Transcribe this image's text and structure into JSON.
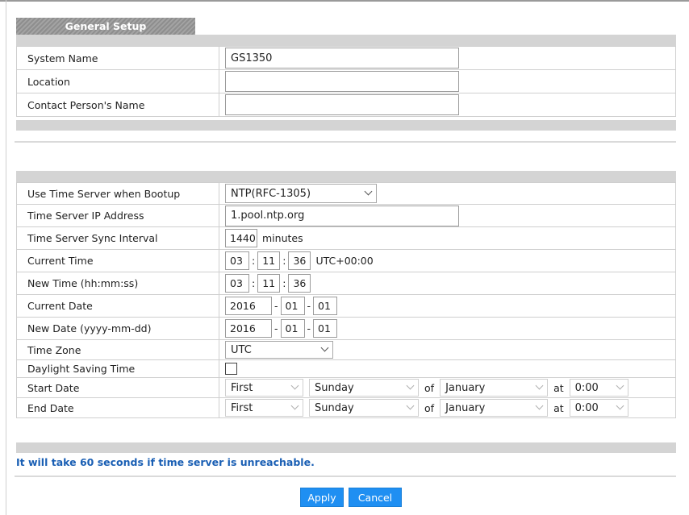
{
  "tab_title": "General Setup",
  "system": {
    "rows": [
      {
        "label": "System Name",
        "value": "GS1350"
      },
      {
        "label": "Location",
        "value": ""
      },
      {
        "label": "Contact Person's Name",
        "value": ""
      }
    ]
  },
  "time": {
    "time_server": {
      "label": "Use Time Server when Bootup",
      "selected": "NTP(RFC-1305)"
    },
    "server_ip": {
      "label": "Time Server IP Address",
      "value": "1.pool.ntp.org"
    },
    "sync_interval": {
      "label": "Time Server Sync Interval",
      "value": "1440",
      "unit": "minutes"
    },
    "current_time": {
      "label": "Current Time",
      "hh": "03",
      "mm": "11",
      "ss": "36",
      "sep": ":",
      "tz": "UTC+00:00"
    },
    "new_time": {
      "label": "New Time (hh:mm:ss)",
      "hh": "03",
      "mm": "11",
      "ss": "36"
    },
    "current_date": {
      "label": "Current Date",
      "yyyy": "2016",
      "mm": "01",
      "dd": "01",
      "sep": "-"
    },
    "new_date": {
      "label": "New Date (yyyy-mm-dd)",
      "yyyy": "2016",
      "mm": "01",
      "dd": "01"
    },
    "time_zone": {
      "label": "Time Zone",
      "selected": "UTC"
    },
    "dst": {
      "label": "Daylight Saving Time",
      "checked": false
    },
    "start_date": {
      "label": "Start Date",
      "week": "First",
      "day": "Sunday",
      "of": "of",
      "month": "January",
      "at": "at",
      "time": "0:00"
    },
    "end_date": {
      "label": "End Date",
      "week": "First",
      "day": "Sunday",
      "of": "of",
      "month": "January",
      "at": "at",
      "time": "0:00"
    }
  },
  "note": "It will take 60 seconds if time server is unreachable.",
  "buttons": {
    "apply": "Apply",
    "cancel": "Cancel"
  }
}
